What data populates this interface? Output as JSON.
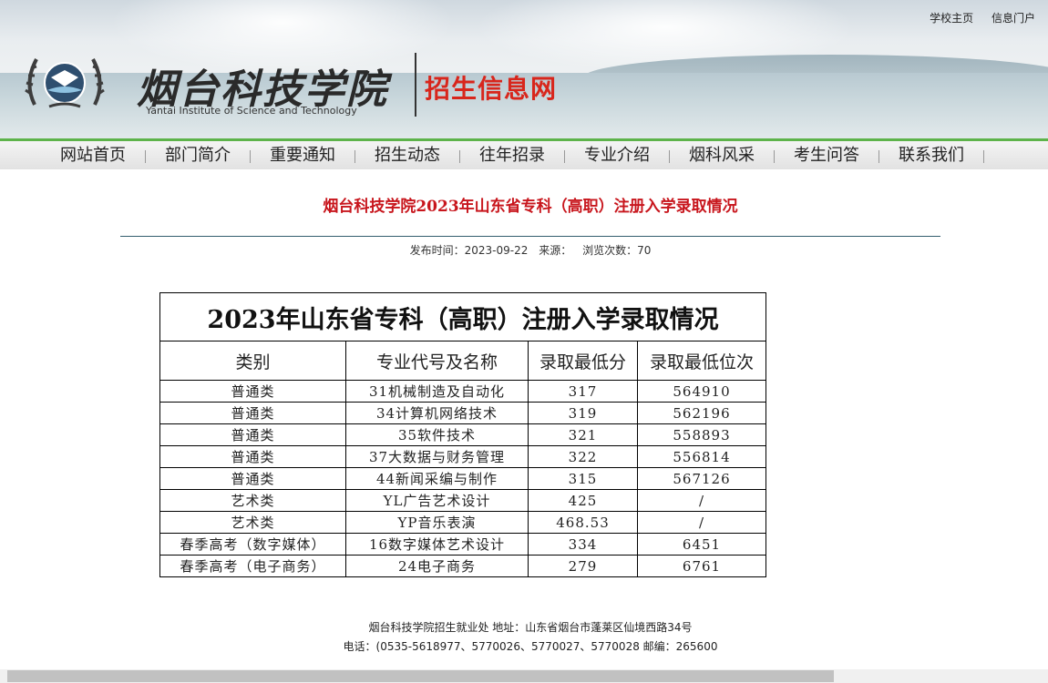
{
  "top_links": [
    "学校主页",
    "信息门户"
  ],
  "logo": {
    "cn_name": "烟台科技学院",
    "en_name": "Yantai Institute of Science and Technology",
    "sub_title": "招生信息网"
  },
  "nav": [
    "网站首页",
    "部门简介",
    "重要通知",
    "招生动态",
    "往年招录",
    "专业介绍",
    "烟科风采",
    "考生问答",
    "联系我们"
  ],
  "article": {
    "title": "烟台科技学院2023年山东省专科（高职）注册入学录取情况",
    "publish_label": "发布时间：2023-09-22",
    "source_label": "来源：",
    "views_label": "浏览次数：70"
  },
  "table": {
    "title": "2023年山东省专科（高职）注册入学录取情况",
    "headers": [
      "类别",
      "专业代号及名称",
      "录取最低分",
      "录取最低位次"
    ],
    "rows": [
      [
        "普通类",
        "31机械制造及自动化",
        "317",
        "564910"
      ],
      [
        "普通类",
        "34计算机网络技术",
        "319",
        "562196"
      ],
      [
        "普通类",
        "35软件技术",
        "321",
        "558893"
      ],
      [
        "普通类",
        "37大数据与财务管理",
        "322",
        "556814"
      ],
      [
        "普通类",
        "44新闻采编与制作",
        "315",
        "567126"
      ],
      [
        "艺术类",
        "YL广告艺术设计",
        "425",
        "/"
      ],
      [
        "艺术类",
        "YP音乐表演",
        "468.53",
        "/"
      ],
      [
        "春季高考（数字媒体）",
        "16数字媒体艺术设计",
        "334",
        "6451"
      ],
      [
        "春季高考（电子商务）",
        "24电子商务",
        "279",
        "6761"
      ]
    ]
  },
  "footer": {
    "line1": "烟台科技学院招生就业处  地址：山东省烟台市蓬莱区仙境西路34号",
    "line2": "电话：(0535-5618977、5770026、5770027、5770028  邮编：265600"
  },
  "colors": {
    "accent_red": "#c8161d",
    "nav_green": "#5db34a",
    "recruit_red": "#d8261c"
  }
}
